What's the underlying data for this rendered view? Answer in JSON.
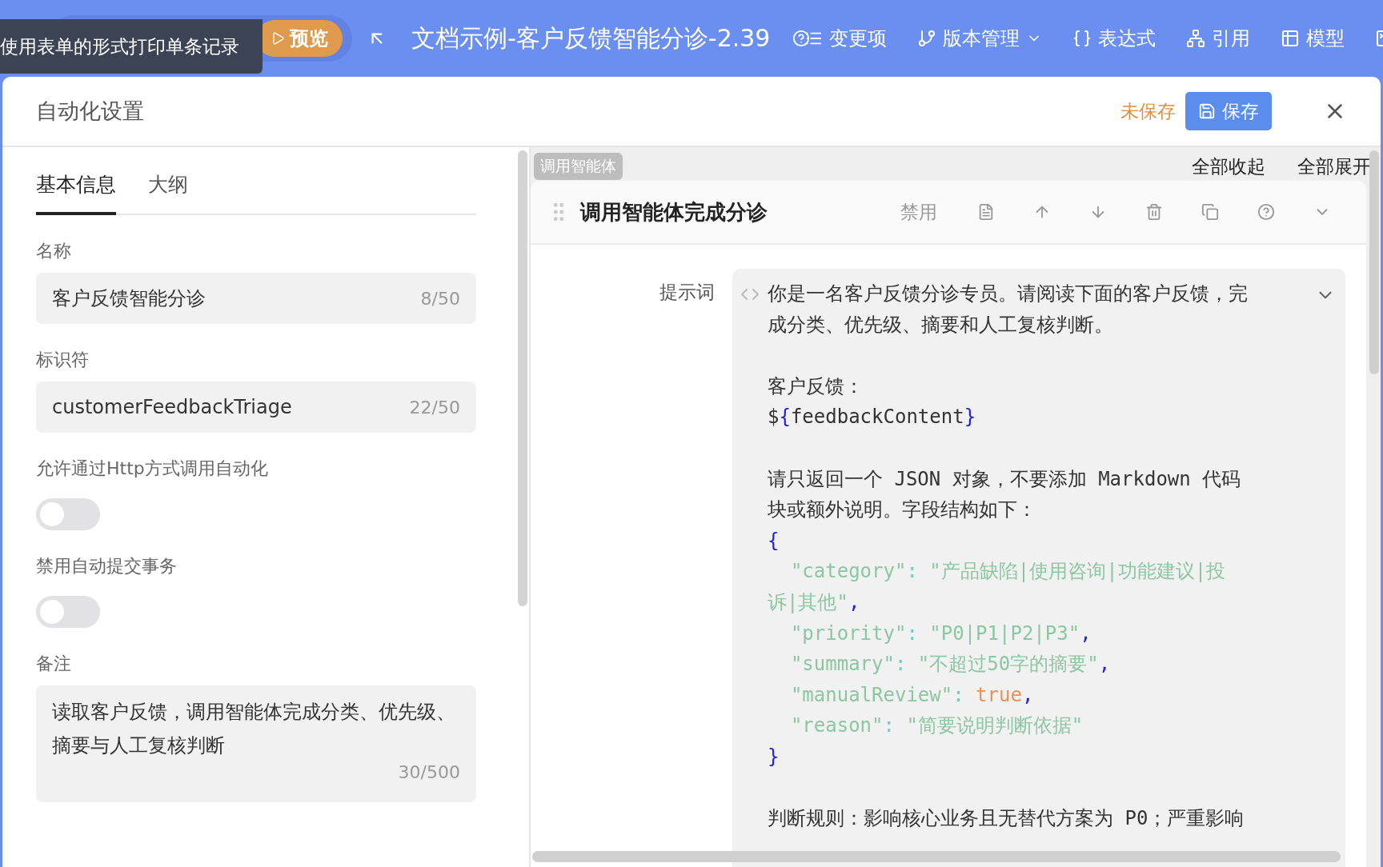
{
  "top_bar": {
    "preview_button": "预览",
    "title": "文档示例-客户反馈智能分诊-2.39",
    "tooltip": "使用表单的形式打印单条记录",
    "tools": [
      {
        "kind": "changes",
        "label": "变更项",
        "dropdown": false
      },
      {
        "kind": "version",
        "label": "版本管理",
        "dropdown": true
      },
      {
        "kind": "expression",
        "label": "表达式",
        "dropdown": false
      },
      {
        "kind": "reference",
        "label": "引用",
        "dropdown": false
      },
      {
        "kind": "model",
        "label": "模型",
        "dropdown": false
      },
      {
        "kind": "terminal",
        "dropdown": false
      }
    ]
  },
  "modal": {
    "title": "自动化设置",
    "unsaved": "未保存",
    "save_button": "保存"
  },
  "left": {
    "tabs": [
      {
        "label": "基本信息",
        "selected": true
      },
      {
        "label": "大纲",
        "selected": false
      }
    ],
    "fields": [
      {
        "kind": "input",
        "label": "名称",
        "value": "客户反馈智能分诊",
        "count": "8/50"
      },
      {
        "kind": "input",
        "label": "标识符",
        "value": "customerFeedbackTriage",
        "count": "22/50"
      },
      {
        "kind": "toggle",
        "label": "允许通过Http方式调用自动化",
        "on": false
      },
      {
        "kind": "toggle",
        "label": "禁用自动提交事务",
        "on": false
      },
      {
        "kind": "textarea",
        "label": "备注",
        "value": "读取客户反馈，调用智能体完成分类、优先级、摘要与人工复核判断",
        "count": "30/500"
      }
    ]
  },
  "right": {
    "tag": "调用智能体",
    "collapse_all": "全部收起",
    "expand_all": "全部展开",
    "step": {
      "title": "调用智能体完成分诊",
      "disable_button": "禁用",
      "prompt_label": "提示词",
      "prompt_lines": [
        {
          "kind": "text",
          "tokens": [
            {
              "kind": "plain",
              "s": "你是一名客户反馈分诊专员。请阅读下面的客户反馈，完"
            }
          ]
        },
        {
          "kind": "text",
          "tokens": [
            {
              "kind": "plain",
              "s": "成分类、优先级、摘要和人工复核判断。"
            }
          ]
        },
        {
          "kind": "blank"
        },
        {
          "kind": "text",
          "tokens": [
            {
              "kind": "plain",
              "s": "客户反馈："
            }
          ]
        },
        {
          "kind": "text",
          "tokens": [
            {
              "kind": "plain",
              "s": "$"
            },
            {
              "kind": "brace",
              "s": "{"
            },
            {
              "kind": "plain",
              "s": "feedbackContent"
            },
            {
              "kind": "brace",
              "s": "}"
            }
          ]
        },
        {
          "kind": "blank"
        },
        {
          "kind": "text",
          "tokens": [
            {
              "kind": "plain",
              "s": "请只返回一个 JSON 对象，不要添加 Markdown 代码"
            }
          ]
        },
        {
          "kind": "text",
          "tokens": [
            {
              "kind": "plain",
              "s": "块或额外说明。字段结构如下："
            }
          ]
        },
        {
          "kind": "text",
          "tokens": [
            {
              "kind": "brace",
              "s": "{"
            }
          ]
        },
        {
          "kind": "text",
          "tokens": [
            {
              "kind": "string",
              "s": "  \"category\""
            },
            {
              "kind": "colon",
              "s": ": "
            },
            {
              "kind": "string",
              "s": "\"产品缺陷|使用咨询|功能建议|投"
            }
          ]
        },
        {
          "kind": "text",
          "tokens": [
            {
              "kind": "string",
              "s": "诉|其他\""
            },
            {
              "kind": "comma",
              "s": ","
            }
          ]
        },
        {
          "kind": "text",
          "tokens": [
            {
              "kind": "string",
              "s": "  \"priority\""
            },
            {
              "kind": "colon",
              "s": ": "
            },
            {
              "kind": "string",
              "s": "\"P0|P1|P2|P3\""
            },
            {
              "kind": "comma",
              "s": ","
            }
          ]
        },
        {
          "kind": "text",
          "tokens": [
            {
              "kind": "string",
              "s": "  \"summary\""
            },
            {
              "kind": "colon",
              "s": ": "
            },
            {
              "kind": "string",
              "s": "\"不超过50字的摘要\""
            },
            {
              "kind": "comma",
              "s": ","
            }
          ]
        },
        {
          "kind": "text",
          "tokens": [
            {
              "kind": "string",
              "s": "  \"manualReview\""
            },
            {
              "kind": "colon",
              "s": ": "
            },
            {
              "kind": "bool",
              "s": "true"
            },
            {
              "kind": "comma",
              "s": ","
            }
          ]
        },
        {
          "kind": "text",
          "tokens": [
            {
              "kind": "string",
              "s": "  \"reason\""
            },
            {
              "kind": "colon",
              "s": ": "
            },
            {
              "kind": "string",
              "s": "\"简要说明判断依据\""
            }
          ]
        },
        {
          "kind": "text",
          "tokens": [
            {
              "kind": "brace",
              "s": "}"
            }
          ]
        },
        {
          "kind": "blank"
        },
        {
          "kind": "text",
          "tokens": [
            {
              "kind": "plain",
              "s": "判断规则：影响核心业务且无替代方案为 P0；严重影响"
            }
          ]
        }
      ]
    }
  }
}
